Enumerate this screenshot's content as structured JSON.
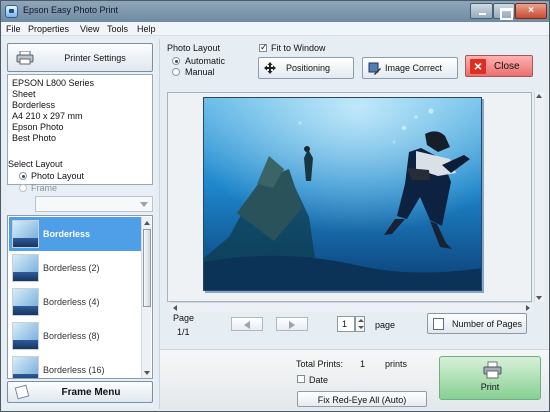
{
  "window": {
    "title": "Epson Easy Photo Print"
  },
  "menu": [
    "File",
    "Properties",
    "View",
    "Tools",
    "Help"
  ],
  "left": {
    "printer_settings_label": "Printer Settings",
    "printer_info": [
      "EPSON L800 Series",
      "Sheet",
      "Borderless",
      "A4 210 x 297 mm",
      "Epson Photo",
      "Best Photo"
    ],
    "select_layout_label": "Select Layout",
    "layout_options": [
      {
        "label": "Photo Layout",
        "selected": true,
        "enabled": true
      },
      {
        "label": "Frame",
        "selected": false,
        "enabled": false
      }
    ],
    "layouts": [
      {
        "label": "Borderless",
        "selected": true
      },
      {
        "label": "Borderless (2)",
        "selected": false
      },
      {
        "label": "Borderless (4)",
        "selected": false
      },
      {
        "label": "Borderless (8)",
        "selected": false
      },
      {
        "label": "Borderless (16)",
        "selected": false
      }
    ],
    "frame_menu_label": "Frame Menu"
  },
  "top": {
    "photo_layout_label": "Photo Layout",
    "automatic_label": "Automatic",
    "manual_label": "Manual",
    "fit_to_window_label": "Fit to Window",
    "positioning_label": "Positioning",
    "image_correct_label": "Image Correct",
    "close_label": "Close"
  },
  "page": {
    "page_label": "Page",
    "page_count": "1/1",
    "current_page": "1",
    "page_unit": "page",
    "number_of_pages_label": "Number of Pages"
  },
  "bottom": {
    "total_prints_label": "Total Prints:",
    "total_prints_value": "1",
    "prints_unit": "prints",
    "date_label": "Date",
    "fix_redeye_label": "Fix Red-Eye All (Auto)",
    "print_label": "Print"
  },
  "colors": {
    "selection_blue": "#4f9fe8",
    "print_green": "#86d092",
    "close_red": "#e02d22",
    "sea_blue": "#1b6fae"
  }
}
